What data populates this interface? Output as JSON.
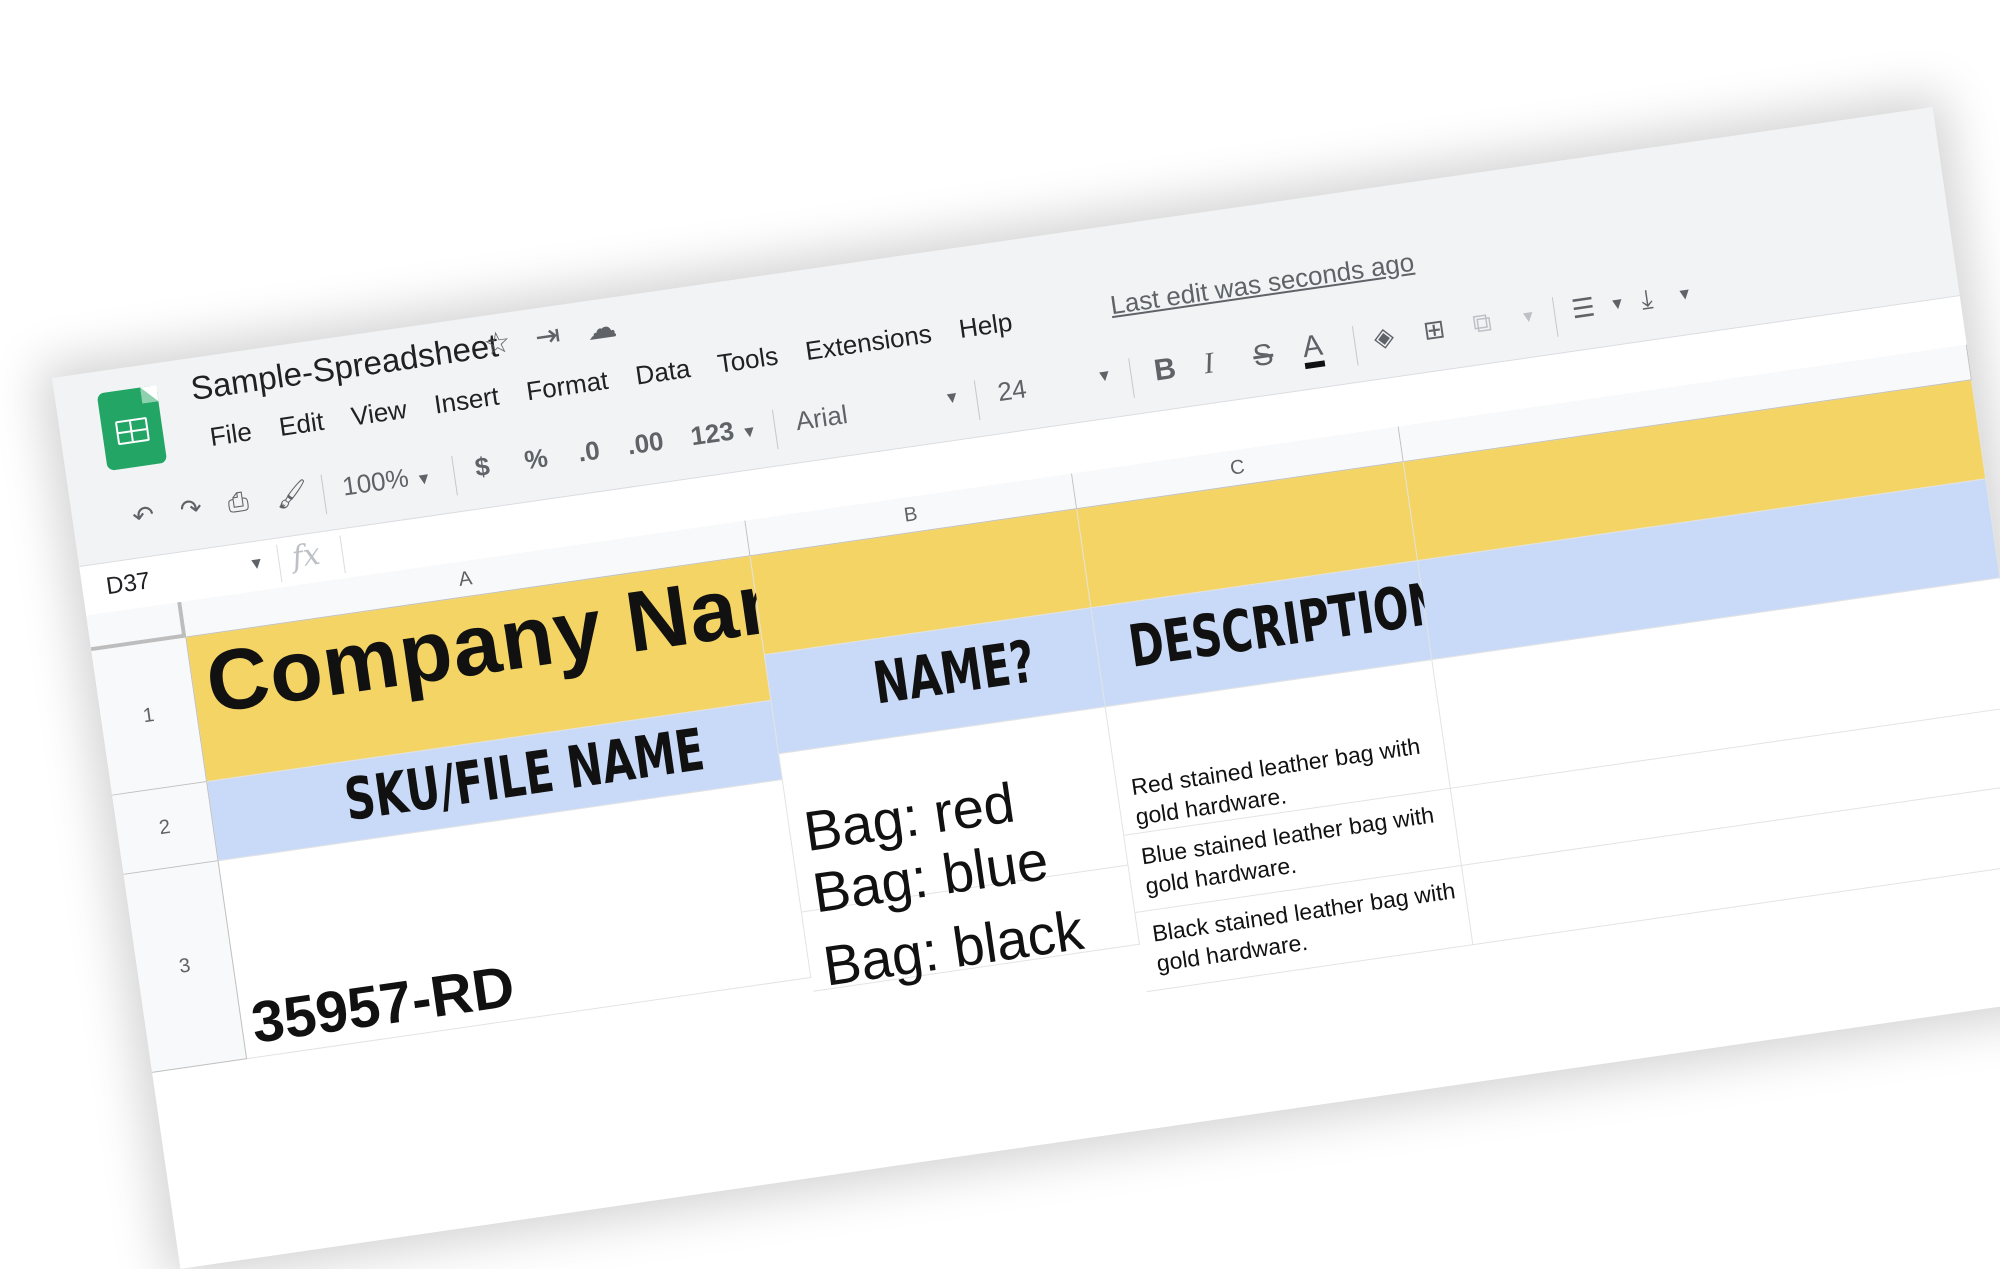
{
  "app": {
    "doc_title": "Sample-Spreadsheet",
    "header_icons": [
      "star-icon",
      "move-to-folder-icon",
      "cloud-saved-icon"
    ],
    "last_edit": "Last edit was seconds ago"
  },
  "menu": [
    "File",
    "Edit",
    "View",
    "Insert",
    "Format",
    "Data",
    "Tools",
    "Extensions",
    "Help"
  ],
  "toolbar": {
    "zoom": "100%",
    "currency": "$",
    "percent": "%",
    "decrease_decimal": ".0",
    "increase_decimal": ".00",
    "more_formats": "123",
    "font": "Arial",
    "font_size": "24",
    "bold": "B",
    "italic": "I",
    "strikethrough": "S",
    "text_color": "A"
  },
  "formula_bar": {
    "name_box": "D37",
    "fx": "fx"
  },
  "grid": {
    "columns": [
      "A",
      "B",
      "C"
    ],
    "rows": [
      "1",
      "2",
      "3"
    ],
    "company": "Company Name",
    "headers": {
      "a": "SKU/FILE NAME",
      "b": "NAME?",
      "c": "DESCRIPTION"
    },
    "sku": "35957-RD",
    "names": [
      "Bag: red",
      "Bag: blue",
      "Bag: black"
    ],
    "descriptions": [
      "Red stained leather bag with gold hardware.",
      "Blue stained leather bag with gold hardware.",
      "Black stained leather bag with gold hardware."
    ]
  },
  "colors": {
    "header_yellow": "#f4d465",
    "header_blue": "#c9daf8",
    "sheets_green": "#23a566"
  }
}
